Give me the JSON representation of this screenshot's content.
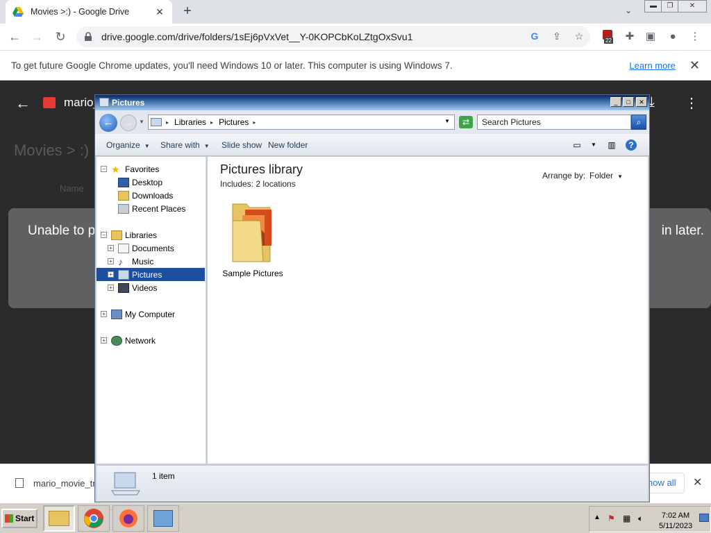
{
  "browser": {
    "tab_title": "Movies >:) - Google Drive",
    "url": "drive.google.com/drive/folders/1sEj6pVxVet__Y-0KOPCbKoLZtgOxSvu1",
    "extension_badge": "22"
  },
  "infobar": {
    "message": "To get future Google Chrome updates, you'll need Windows 10 or later. This computer is using Windows 7.",
    "learn_more": "Learn more"
  },
  "drive": {
    "file_name": "mario_",
    "breadcrumb": "Movies > :)",
    "name_column": "Name",
    "error_left": "Unable to p",
    "error_right": "in later."
  },
  "download_bar": {
    "file_name": "mario_movie_tr",
    "show_all": "how all"
  },
  "explorer": {
    "title": "Pictures",
    "address": [
      "Libraries",
      "Pictures"
    ],
    "search_placeholder": "Search Pictures",
    "commands": {
      "organize": "Organize",
      "share_with": "Share with",
      "slide_show": "Slide show",
      "new_folder": "New folder"
    },
    "nav": {
      "favorites": "Favorites",
      "desktop": "Desktop",
      "downloads": "Downloads",
      "recent_places": "Recent Places",
      "libraries": "Libraries",
      "documents": "Documents",
      "music": "Music",
      "pictures": "Pictures",
      "videos": "Videos",
      "my_computer": "My Computer",
      "network": "Network"
    },
    "library_title": "Pictures library",
    "library_includes": "Includes:  2 locations",
    "arrange_by_label": "Arrange by:",
    "arrange_by_value": "Folder",
    "items": [
      {
        "name": "Sample Pictures"
      }
    ],
    "status_count": "1 item"
  },
  "taskbar": {
    "start_label": "Start",
    "time": "7:02 AM",
    "date": "5/11/2023"
  }
}
